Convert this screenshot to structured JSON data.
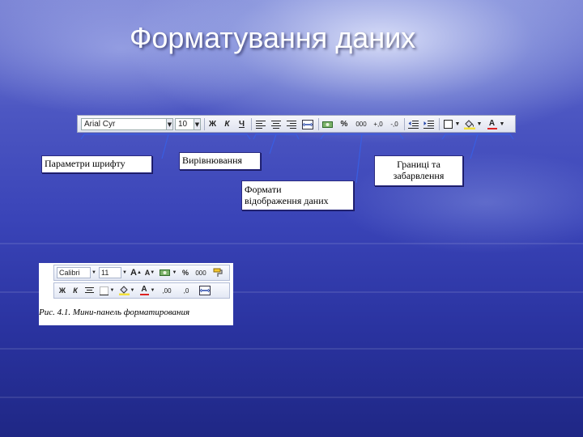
{
  "slide": {
    "title": "Форматування даних"
  },
  "toolbar": {
    "font_name": "Arial Cyr",
    "font_size": "10",
    "bold": "Ж",
    "italic": "К",
    "underline": "Ч",
    "percent": "%",
    "thousands": "000",
    "increase_decimal": "+,0",
    "decrease_decimal": "-,0",
    "font_color_letter": "A"
  },
  "captions": {
    "font_params": "Параметри шрифту",
    "alignment": "Вирівнювання",
    "display_formats_line1": "Формати",
    "display_formats_line2": "відображення даних",
    "borders_line1": "Границі та",
    "borders_line2": "забарвлення"
  },
  "mini_panel": {
    "font_name": "Calibri",
    "font_size": "11",
    "grow_font": "A",
    "shrink_font": "A",
    "percent": "%",
    "thousands": "000",
    "bold": "Ж",
    "italic": "К",
    "font_color_letter": "A",
    "increase_decimal": ",00",
    "decrease_decimal": ",0",
    "caption": "Рис. 4.1. Мини-панель форматирования"
  },
  "colors": {
    "caption_border": "#2a2a80",
    "link_lines": "#3a5de0",
    "title_text": "#ffffff"
  }
}
